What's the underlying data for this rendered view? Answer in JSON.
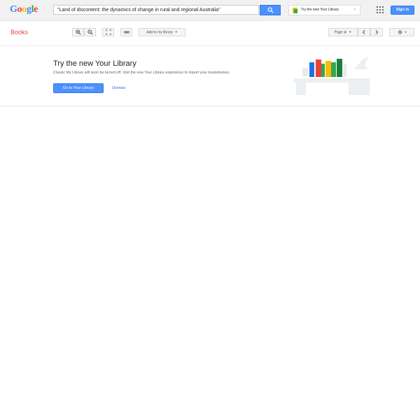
{
  "header": {
    "logo": "Google",
    "logo_letters": [
      {
        "ch": "G",
        "color": "#4285f4"
      },
      {
        "ch": "o",
        "color": "#ea4335"
      },
      {
        "ch": "o",
        "color": "#fbbc05"
      },
      {
        "ch": "g",
        "color": "#4285f4"
      },
      {
        "ch": "l",
        "color": "#34a853"
      },
      {
        "ch": "e",
        "color": "#ea4335"
      }
    ],
    "search_value": "\"Land of discontent: the dynamics of change in rural and regional Australia\"",
    "search_icon": "search-icon",
    "promo_label": "Try the new Your Library",
    "apps_icon": "apps-grid-icon",
    "signin_label": "Sign in"
  },
  "toolbar": {
    "title": "Books",
    "zoom_in_icon": "zoom-in-icon",
    "zoom_out_icon": "zoom-out-icon",
    "fullscreen_icon": "fullscreen-icon",
    "link_icon": "link-icon",
    "add_to_library_label": "Add to my library",
    "page_label": "Page vii",
    "prev_icon": "chevron-left-icon",
    "next_icon": "chevron-right-icon",
    "settings_icon": "gear-icon"
  },
  "banner": {
    "title": "Try the new Your Library",
    "text": "Classic My Library will soon be turned off. Visit the new Your Library experience to import your bookshelves.",
    "go_label": "Go to Your Library",
    "dismiss_label": "Dismiss"
  },
  "colors": {
    "accent_blue": "#4d90fe",
    "books_red": "#dd4b39",
    "link_blue": "#1a73e8"
  }
}
